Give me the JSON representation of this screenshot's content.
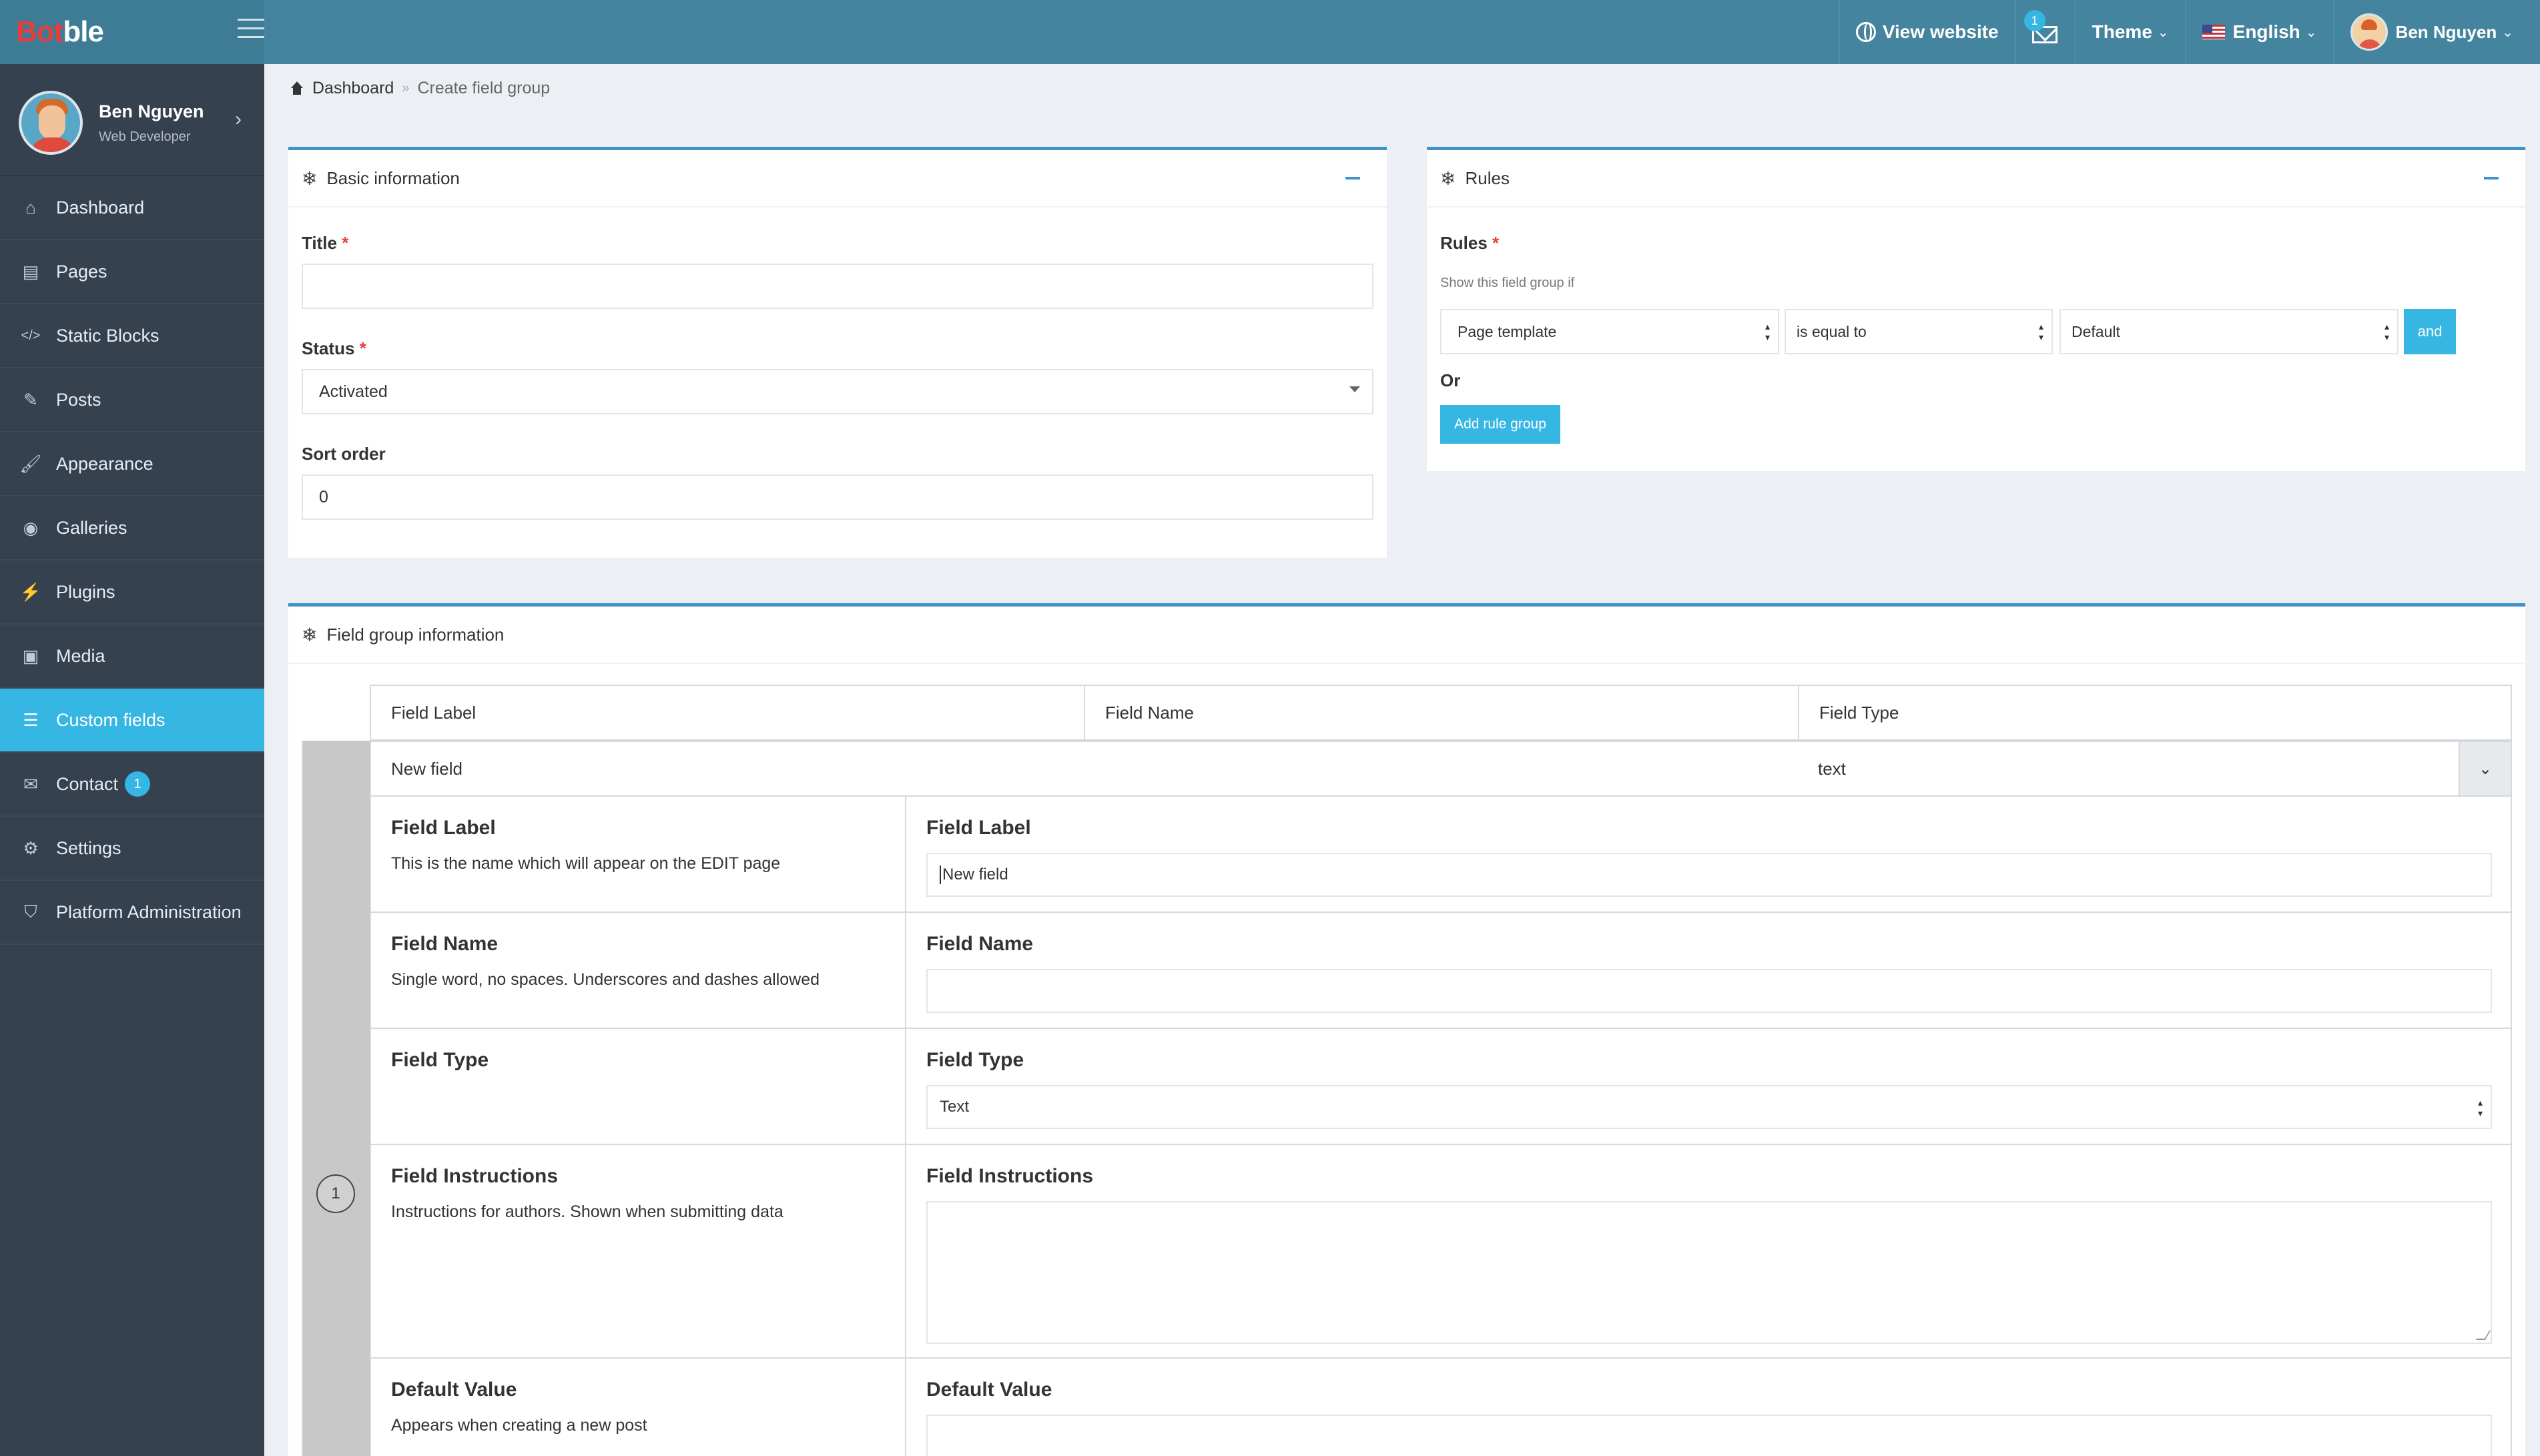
{
  "header": {
    "logo_part1": "Bot",
    "logo_part2": "ble",
    "view_website": "View website",
    "mail_badge": "1",
    "theme": "Theme",
    "language": "English",
    "user": "Ben Nguyen"
  },
  "sidebar": {
    "profile": {
      "name": "Ben Nguyen",
      "role": "Web Developer"
    },
    "items": [
      {
        "label": "Dashboard",
        "icon": "home-icon",
        "glyph": "⌂"
      },
      {
        "label": "Pages",
        "icon": "book-icon",
        "glyph": "▤"
      },
      {
        "label": "Static Blocks",
        "icon": "code-icon",
        "glyph": "</>"
      },
      {
        "label": "Posts",
        "icon": "edit-icon",
        "glyph": "✎"
      },
      {
        "label": "Appearance",
        "icon": "paintbrush-icon",
        "glyph": "🖌"
      },
      {
        "label": "Galleries",
        "icon": "camera-icon",
        "glyph": "◉"
      },
      {
        "label": "Plugins",
        "icon": "plug-icon",
        "glyph": "⚡"
      },
      {
        "label": "Media",
        "icon": "image-icon",
        "glyph": "▣"
      },
      {
        "label": "Custom fields",
        "icon": "list-icon",
        "glyph": "☰"
      },
      {
        "label": "Contact",
        "icon": "envelope-icon",
        "glyph": "✉",
        "badge": "1"
      },
      {
        "label": "Settings",
        "icon": "cogs-icon",
        "glyph": "⚙"
      },
      {
        "label": "Platform Administration",
        "icon": "shield-icon",
        "glyph": "⛉"
      }
    ]
  },
  "breadcrumb": {
    "home": "Dashboard",
    "current": "Create field group"
  },
  "basic_info": {
    "title": "Basic information",
    "title_label": "Title",
    "title_value": "",
    "status_label": "Status",
    "status_value": "Activated",
    "sort_label": "Sort order",
    "sort_value": "0"
  },
  "rules": {
    "title": "Rules",
    "label": "Rules",
    "hint": "Show this field group if",
    "rule_param": "Page template",
    "rule_operator": "is equal to",
    "rule_value": "Default",
    "and_button": "and",
    "or_label": "Or",
    "add_group_button": "Add rule group"
  },
  "field_group": {
    "title": "Field group information",
    "columns": [
      "Field Label",
      "Field Name",
      "Field Type"
    ],
    "field": {
      "number": "1",
      "label": "New field",
      "type": "text",
      "rows": [
        {
          "title": "Field Label",
          "desc": "This is the name which will appear on the EDIT page",
          "right_title": "Field Label",
          "value": "New field"
        },
        {
          "title": "Field Name",
          "desc": "Single word, no spaces. Underscores and dashes allowed",
          "right_title": "Field Name",
          "value": ""
        },
        {
          "title": "Field Type",
          "desc": "",
          "right_title": "Field Type",
          "value": "Text"
        },
        {
          "title": "Field Instructions",
          "desc": "Instructions for authors. Shown when submitting data",
          "right_title": "Field Instructions",
          "value": ""
        },
        {
          "title": "Default Value",
          "desc": "Appears when creating a new post",
          "right_title": "Default Value",
          "value": ""
        }
      ]
    }
  }
}
